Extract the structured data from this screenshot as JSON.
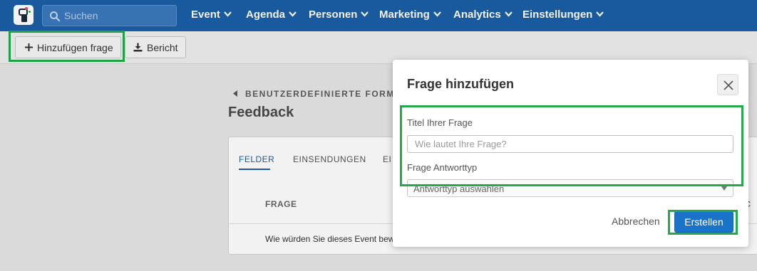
{
  "nav": {
    "search_placeholder": "Suchen",
    "items": [
      {
        "label": "Event"
      },
      {
        "label": "Agenda"
      },
      {
        "label": "Personen"
      },
      {
        "label": "Marketing"
      },
      {
        "label": "Analytics"
      },
      {
        "label": "Einstellungen"
      }
    ]
  },
  "toolbar": {
    "add_label": "Hinzufügen frage",
    "report_label": "Bericht"
  },
  "page": {
    "breadcrumb": "BENUTZERDEFINIERTE FORMUL",
    "title": "Feedback",
    "tabs": [
      {
        "label": "FELDER",
        "active": true
      },
      {
        "label": "EINSENDUNGEN",
        "active": false
      },
      {
        "label": "EI",
        "active": false
      }
    ],
    "table": {
      "column_header": "FRAGE",
      "column_header_2": "IC",
      "rows": [
        {
          "question": "Wie würden Sie dieses Event bew"
        }
      ]
    }
  },
  "modal": {
    "title": "Frage hinzufügen",
    "title_field_label": "Titel Ihrer Frage",
    "title_field_placeholder": "Wie lautet Ihre Frage?",
    "type_field_label": "Frage Antworttyp",
    "type_field_value": "Antworttyp auswählen",
    "cancel_label": "Abbrechen",
    "create_label": "Erstellen"
  },
  "colors": {
    "nav_bg": "#1b5fa8",
    "primary_button": "#1b72c9",
    "highlight_box": "#22aa4a"
  },
  "icons": [
    "logo-icon",
    "search-icon",
    "chevron-down-icon",
    "plus-icon",
    "download-icon",
    "back-arrow-icon",
    "close-icon",
    "caret-down-icon"
  ]
}
